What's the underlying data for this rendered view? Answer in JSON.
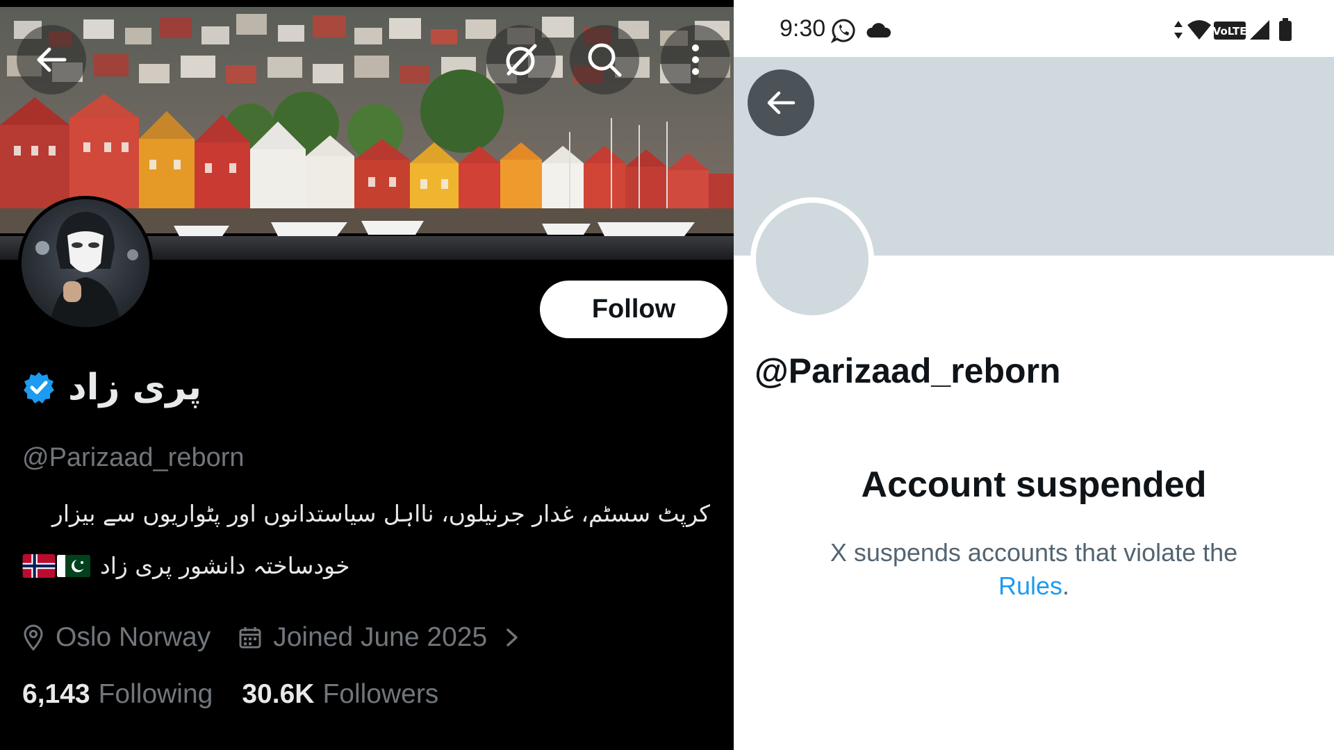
{
  "left_profile": {
    "display_name": "پری زاد",
    "handle": "@Parizaad_reborn",
    "follow_label": "Follow",
    "bio_line1": "کرپٹ سسٹم، غدار جرنیلوں، نااہل سیاستدانوں اور پٹواریوں سے بیزار",
    "bio_line2": "خودساختہ دانشور پری زاد",
    "location": "Oslo Norway",
    "joined": "Joined June 2025",
    "following_count": "6,143",
    "following_label": "Following",
    "followers_count": "30.6K",
    "followers_label": "Followers",
    "icons": [
      "back-arrow-icon",
      "grok-icon",
      "search-icon",
      "more-vertical-icon",
      "verified-badge-icon",
      "location-pin-icon",
      "calendar-icon",
      "chevron-right-icon",
      "norway-flag-icon",
      "pakistan-flag-icon"
    ]
  },
  "right_profile": {
    "status_time": "9:30",
    "handle": "@Parizaad_reborn",
    "suspended_title": "Account suspended",
    "suspended_body": "X suspends accounts that violate the",
    "rules_link": "Rules",
    "period": ".",
    "status_icons": [
      "whatsapp-icon",
      "cloud-icon",
      "data-arrows-icon",
      "wifi-icon",
      "volte-icon",
      "signal-icon",
      "battery-icon"
    ]
  },
  "colors": {
    "dark_bg": "#000000",
    "text_primary_dark": "#e7e9ea",
    "text_secondary": "#71767b",
    "verified_blue": "#1d9bf0",
    "light_banner": "#cfd9de",
    "link_blue": "#1d9bf0"
  }
}
